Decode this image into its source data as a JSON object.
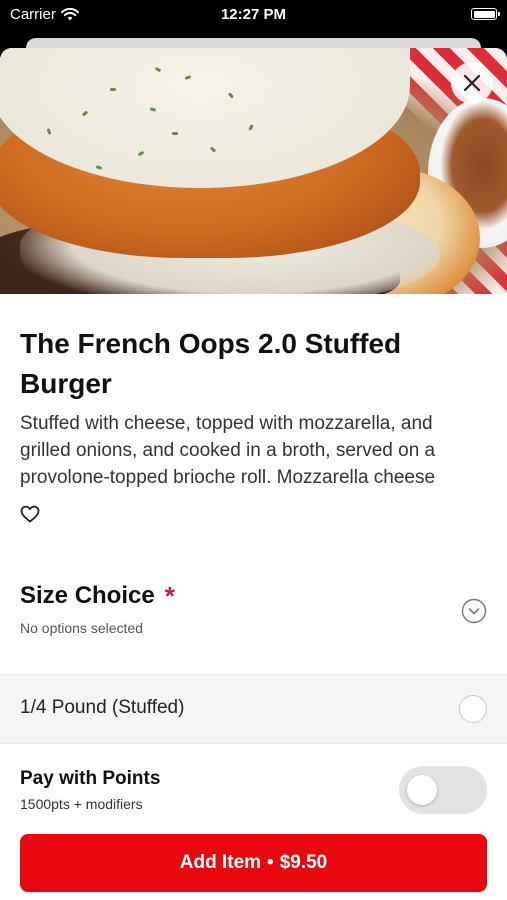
{
  "status_bar": {
    "carrier": "Carrier",
    "time": "12:27 PM"
  },
  "item": {
    "title": "The French Oops 2.0 Stuffed Burger",
    "description": "Stuffed with cheese, topped with mozzarella, and grilled onions, and cooked in a broth, served on a provolone-topped brioche roll. Mozzarella cheese"
  },
  "size_choice": {
    "title": "Size Choice",
    "required_mark": "*",
    "subtitle": "No options selected",
    "options": [
      {
        "label": "1/4 Pound (Stuffed)",
        "selected": false
      }
    ]
  },
  "points": {
    "title": "Pay with Points",
    "subtitle": "1500pts + modifiers",
    "enabled": false
  },
  "add_button": {
    "label": "Add Item",
    "separator": "•",
    "price": "$9.50"
  },
  "colors": {
    "accent_red": "#e8080e",
    "required_star": "#c8174a"
  },
  "icons": [
    "wifi-icon",
    "battery-icon",
    "close-icon",
    "heart-icon",
    "chevron-down-icon"
  ]
}
